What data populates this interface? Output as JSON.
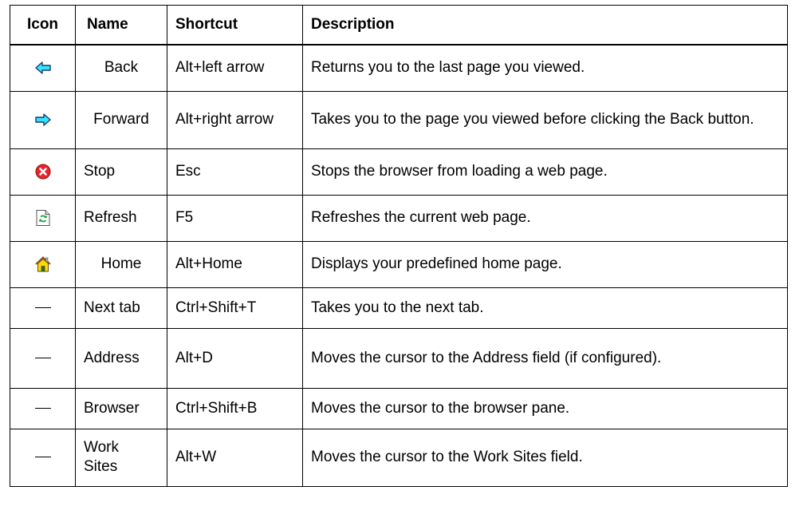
{
  "headers": {
    "icon": "Icon",
    "name": "Name",
    "shortcut": "Shortcut",
    "description": "Description"
  },
  "rows": [
    {
      "icon": "back-arrow-icon",
      "name": "Back",
      "shortcut": "Alt+left arrow",
      "description": "Returns you to the last page you viewed."
    },
    {
      "icon": "forward-arrow-icon",
      "name": "Forward",
      "shortcut": "Alt+right arrow",
      "description": "Takes you to the page you viewed before clicking the Back button."
    },
    {
      "icon": "stop-icon",
      "name": "Stop",
      "shortcut": "Esc",
      "description": "Stops the browser from loading a web page."
    },
    {
      "icon": "refresh-icon",
      "name": "Refresh",
      "shortcut": "F5",
      "description": "Refreshes the current web page."
    },
    {
      "icon": "home-icon",
      "name": "Home",
      "shortcut": "Alt+Home",
      "description": "Displays your predefined home page."
    },
    {
      "icon": "dash-icon",
      "name": "Next tab",
      "shortcut": "Ctrl+Shift+T",
      "description": "Takes you to the next tab."
    },
    {
      "icon": "dash-icon",
      "name": "Address",
      "shortcut": "Alt+D",
      "description": "Moves the cursor to the Address field (if configured)."
    },
    {
      "icon": "dash-icon",
      "name": "Browser",
      "shortcut": "Ctrl+Shift+B",
      "description": "Moves the cursor to the browser pane."
    },
    {
      "icon": "dash-icon",
      "name": "Work Sites",
      "shortcut": "Alt+W",
      "description": "Moves the cursor to the Work Sites field."
    }
  ],
  "colors": {
    "arrow_fill": "#33e6ff",
    "stop_red": "#e8242a",
    "refresh_green": "#1aa33a",
    "home_yellow": "#ffd900",
    "home_roof": "#8a5a2b"
  }
}
